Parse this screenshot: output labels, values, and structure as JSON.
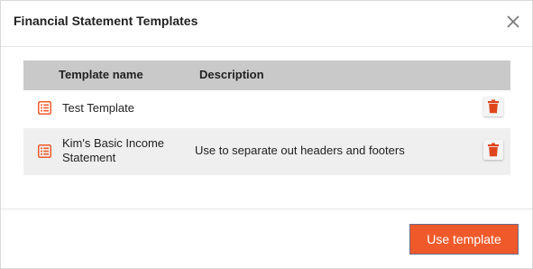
{
  "dialog": {
    "title": "Financial Statement Templates",
    "close_icon": "close-icon"
  },
  "table": {
    "columns": [
      "Template name",
      "Description"
    ],
    "rows": [
      {
        "name": "Test Template",
        "description": ""
      },
      {
        "name": "Kim's Basic Income Statement",
        "description": "Use to separate out headers and footers"
      }
    ]
  },
  "footer": {
    "use_template_label": "Use template"
  },
  "colors": {
    "accent": "#f05a2b",
    "header_row": "#c9c9c9",
    "alt_row": "#efefef"
  }
}
